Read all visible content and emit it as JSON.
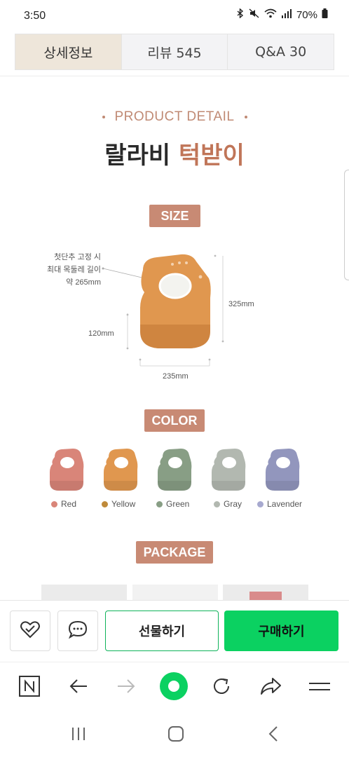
{
  "status_bar": {
    "time": "3:50",
    "battery": "70%"
  },
  "tabs": [
    {
      "label": "상세정보",
      "active": true
    },
    {
      "label": "리뷰 545",
      "active": false
    },
    {
      "label": "Q&A 30",
      "active": false
    }
  ],
  "detail": {
    "section_label": "PRODUCT DETAIL",
    "title_main": "랄라비",
    "title_accent": "턱받이",
    "size_pill": "SIZE",
    "size_note_line1": "첫단추 고정 시",
    "size_note_line2": "최대 목둘레 길이",
    "size_note_line3": "약 265mm",
    "dim_height": "325mm",
    "dim_pocket": "120mm",
    "dim_width": "235mm",
    "color_pill": "COLOR",
    "colors": [
      {
        "name": "Red",
        "hex": "#d98579"
      },
      {
        "name": "Yellow",
        "hex": "#e0974f"
      },
      {
        "name": "Green",
        "hex": "#889e85"
      },
      {
        "name": "Gray",
        "hex": "#b2b8b0"
      },
      {
        "name": "Lavender",
        "hex": "#9296bd"
      }
    ],
    "package_pill": "PACKAGE"
  },
  "action_bar": {
    "gift_label": "선물하기",
    "buy_label": "구매하기"
  },
  "colors": {
    "brand_green": "#0bd161",
    "accent": "#c07558",
    "pill_bg": "#c88a74"
  }
}
